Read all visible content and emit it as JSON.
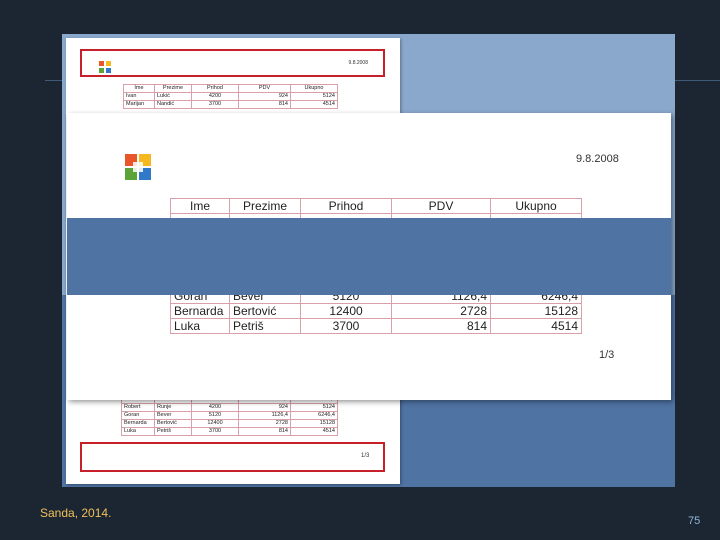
{
  "back_page": {
    "date": "9.8.2008",
    "page_num": "1/3",
    "headers": [
      "Ime",
      "Prezime",
      "Prihod",
      "PDV",
      "Ukupno"
    ],
    "rows_top": [
      [
        "Ivan",
        "Lukić",
        "4200",
        "924",
        "5124"
      ],
      [
        "Marijan",
        "Nandić",
        "3700",
        "814",
        "4514"
      ]
    ],
    "rows_bottom": [
      [
        "Ivica",
        "Lukić",
        "5120",
        "1126,4",
        "6246,4"
      ],
      [
        "Robert",
        "Runje",
        "4200",
        "924",
        "5124"
      ],
      [
        "Goran",
        "Bever",
        "5120",
        "1126,4",
        "6246,4"
      ],
      [
        "Bernarda",
        "Bertović",
        "12400",
        "2728",
        "15128"
      ],
      [
        "Luka",
        "Petriš",
        "3700",
        "814",
        "4514"
      ]
    ]
  },
  "front_page": {
    "date": "9.8.2008",
    "page_num": "1/3",
    "headers": [
      "Ime",
      "Prezime",
      "Prihod",
      "PDV",
      "Ukupno"
    ],
    "rows": [
      [
        "Goran",
        "Bever",
        "5120",
        "1126,4",
        "6246,4"
      ],
      [
        "Bernarda",
        "Bertović",
        "12400",
        "2728",
        "15128"
      ],
      [
        "Luka",
        "Petriš",
        "3700",
        "814",
        "4514"
      ]
    ]
  },
  "footer": {
    "author": "Sanda, 2014.",
    "slide_number": "75"
  },
  "colors": {
    "slide_bg": "#1c2632",
    "panel": "#8aa8cc",
    "overlay": "#4f73a3",
    "accent_red": "#c8202a",
    "footer_text": "#f0c05a"
  }
}
